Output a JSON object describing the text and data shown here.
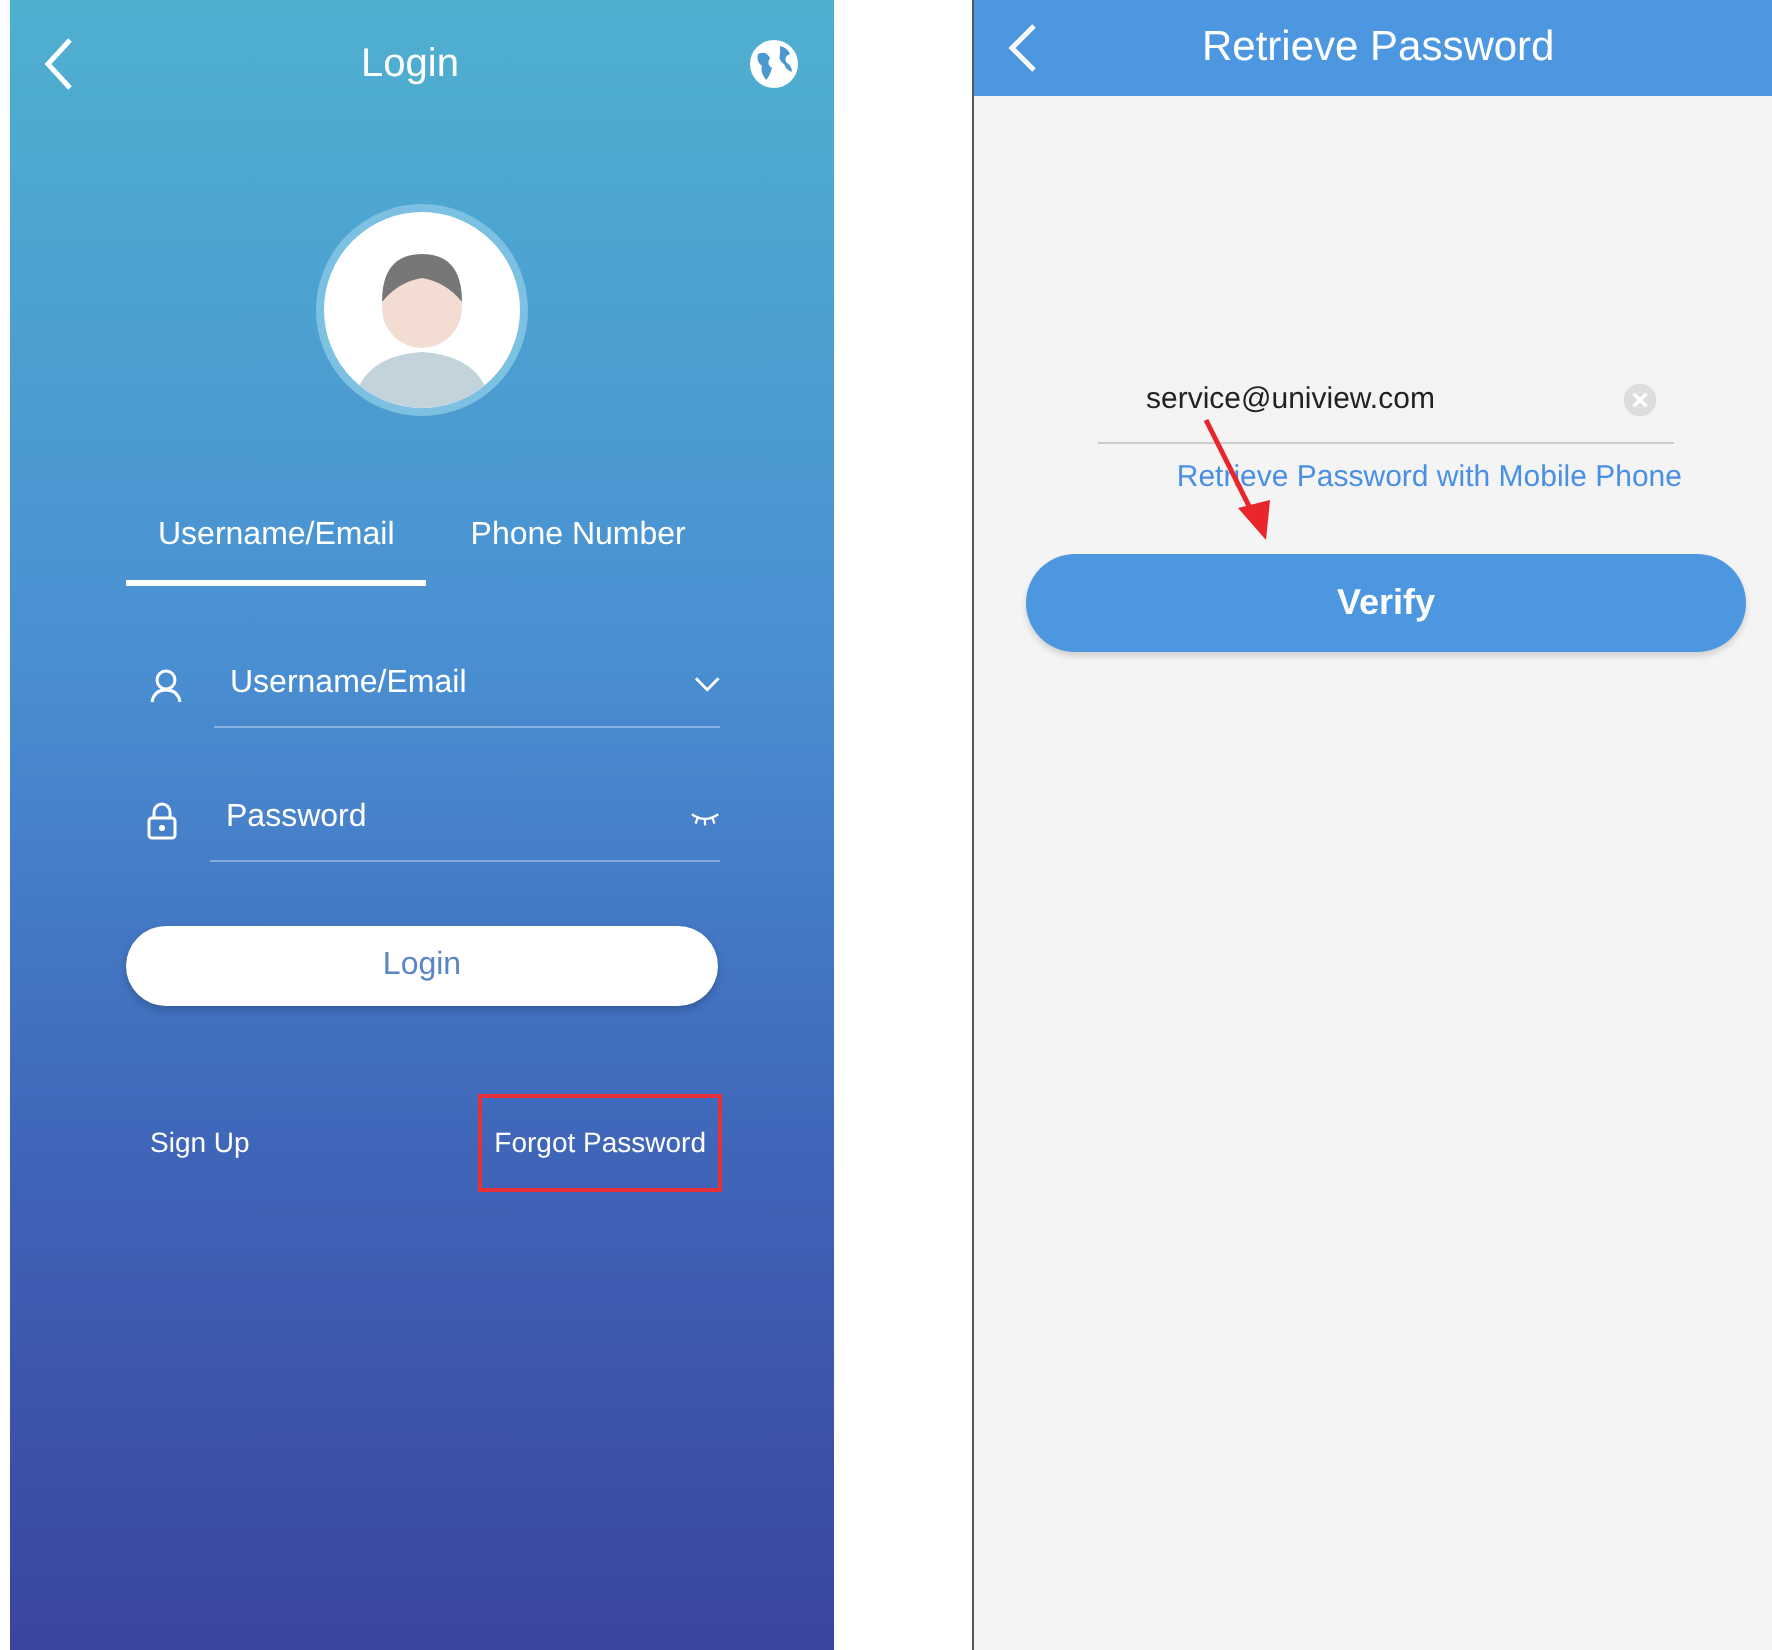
{
  "login_screen": {
    "title": "Login",
    "tabs": [
      {
        "label": "Username/Email",
        "selected": true
      },
      {
        "label": "Phone Number",
        "selected": false
      }
    ],
    "username_field": {
      "placeholder": "Username/Email"
    },
    "password_field": {
      "placeholder": "Password"
    },
    "login_button": "Login",
    "sign_up_link": "Sign Up",
    "forgot_password_link": "Forgot Password",
    "forgot_password_highlighted": true
  },
  "retrieve_screen": {
    "title": "Retrieve Password",
    "email_field": {
      "value": "service@uniview.com"
    },
    "mobile_link": "Retrieve Password with Mobile Phone",
    "verify_button": "Verify"
  }
}
